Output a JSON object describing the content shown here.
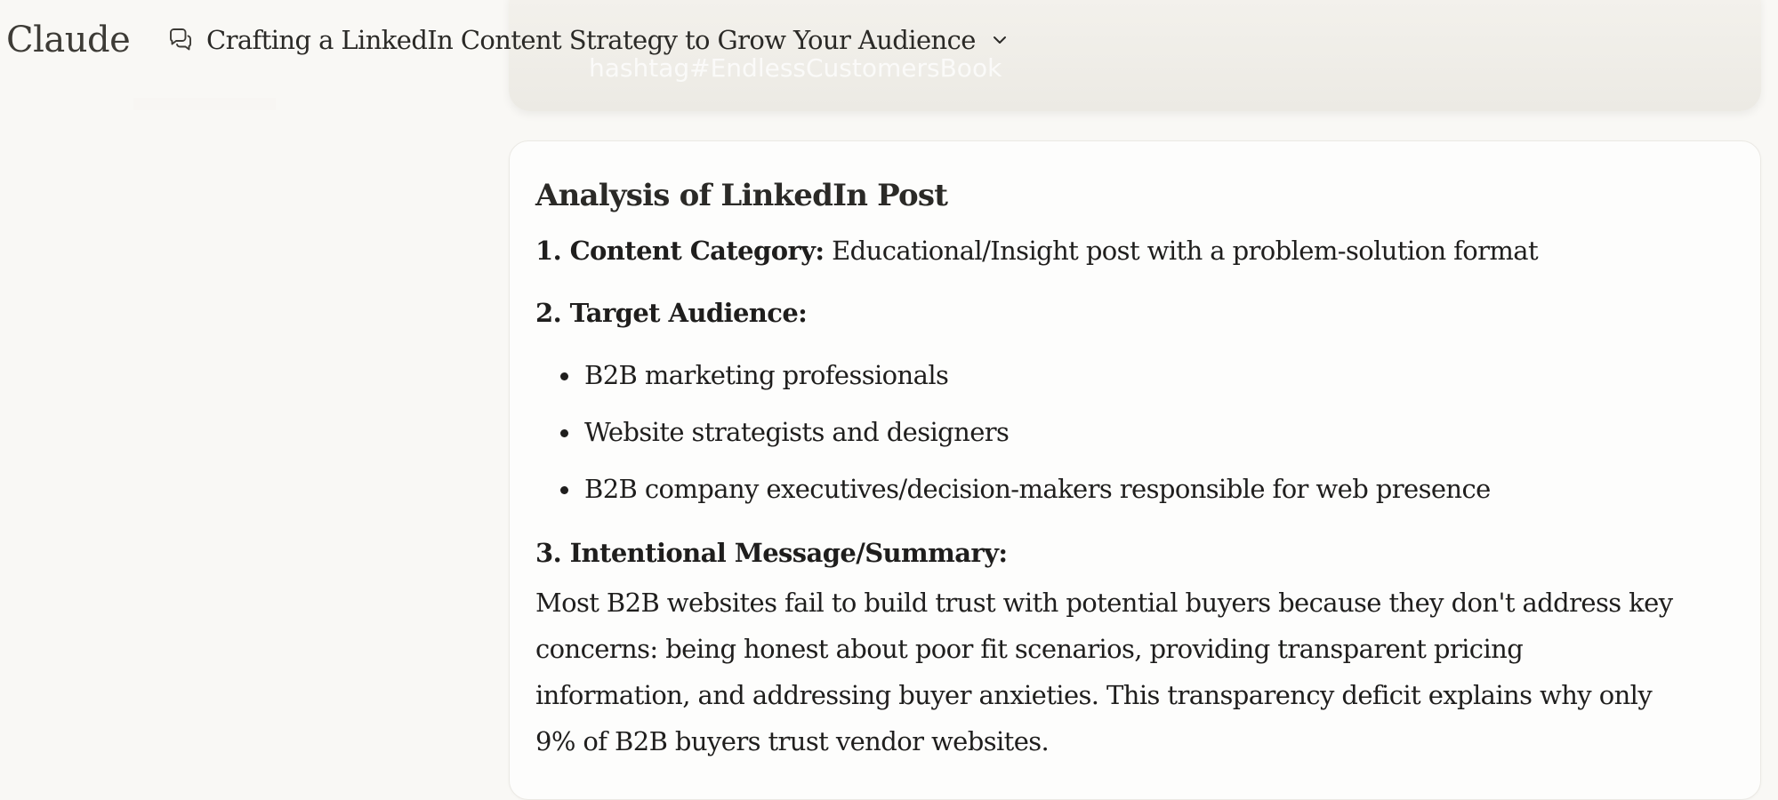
{
  "app": {
    "logo": "Claude"
  },
  "header": {
    "chat_title": "Crafting a LinkedIn Content Strategy to Grow Your Audience"
  },
  "previous_message": {
    "partial_text": "hashtag#EndlessCustomersBook"
  },
  "response": {
    "heading": "Analysis of LinkedIn Post",
    "content_category_label": "1. Content Category:",
    "content_category_value": " Educational/Insight post with a problem-solution format",
    "target_audience_label": "2. Target Audience:",
    "target_audience_items": [
      "B2B marketing professionals",
      "Website strategists and designers",
      "B2B company executives/decision-makers responsible for web presence"
    ],
    "message_label": "3. Intentional Message/Summary:",
    "message_text": "Most B2B websites fail to build trust with potential buyers because they don't address key concerns: being honest about poor fit scenarios, providing transparent pricing information, and addressing buyer anxieties. This transparency deficit explains why only 9% of B2B buyers trust vendor websites."
  }
}
